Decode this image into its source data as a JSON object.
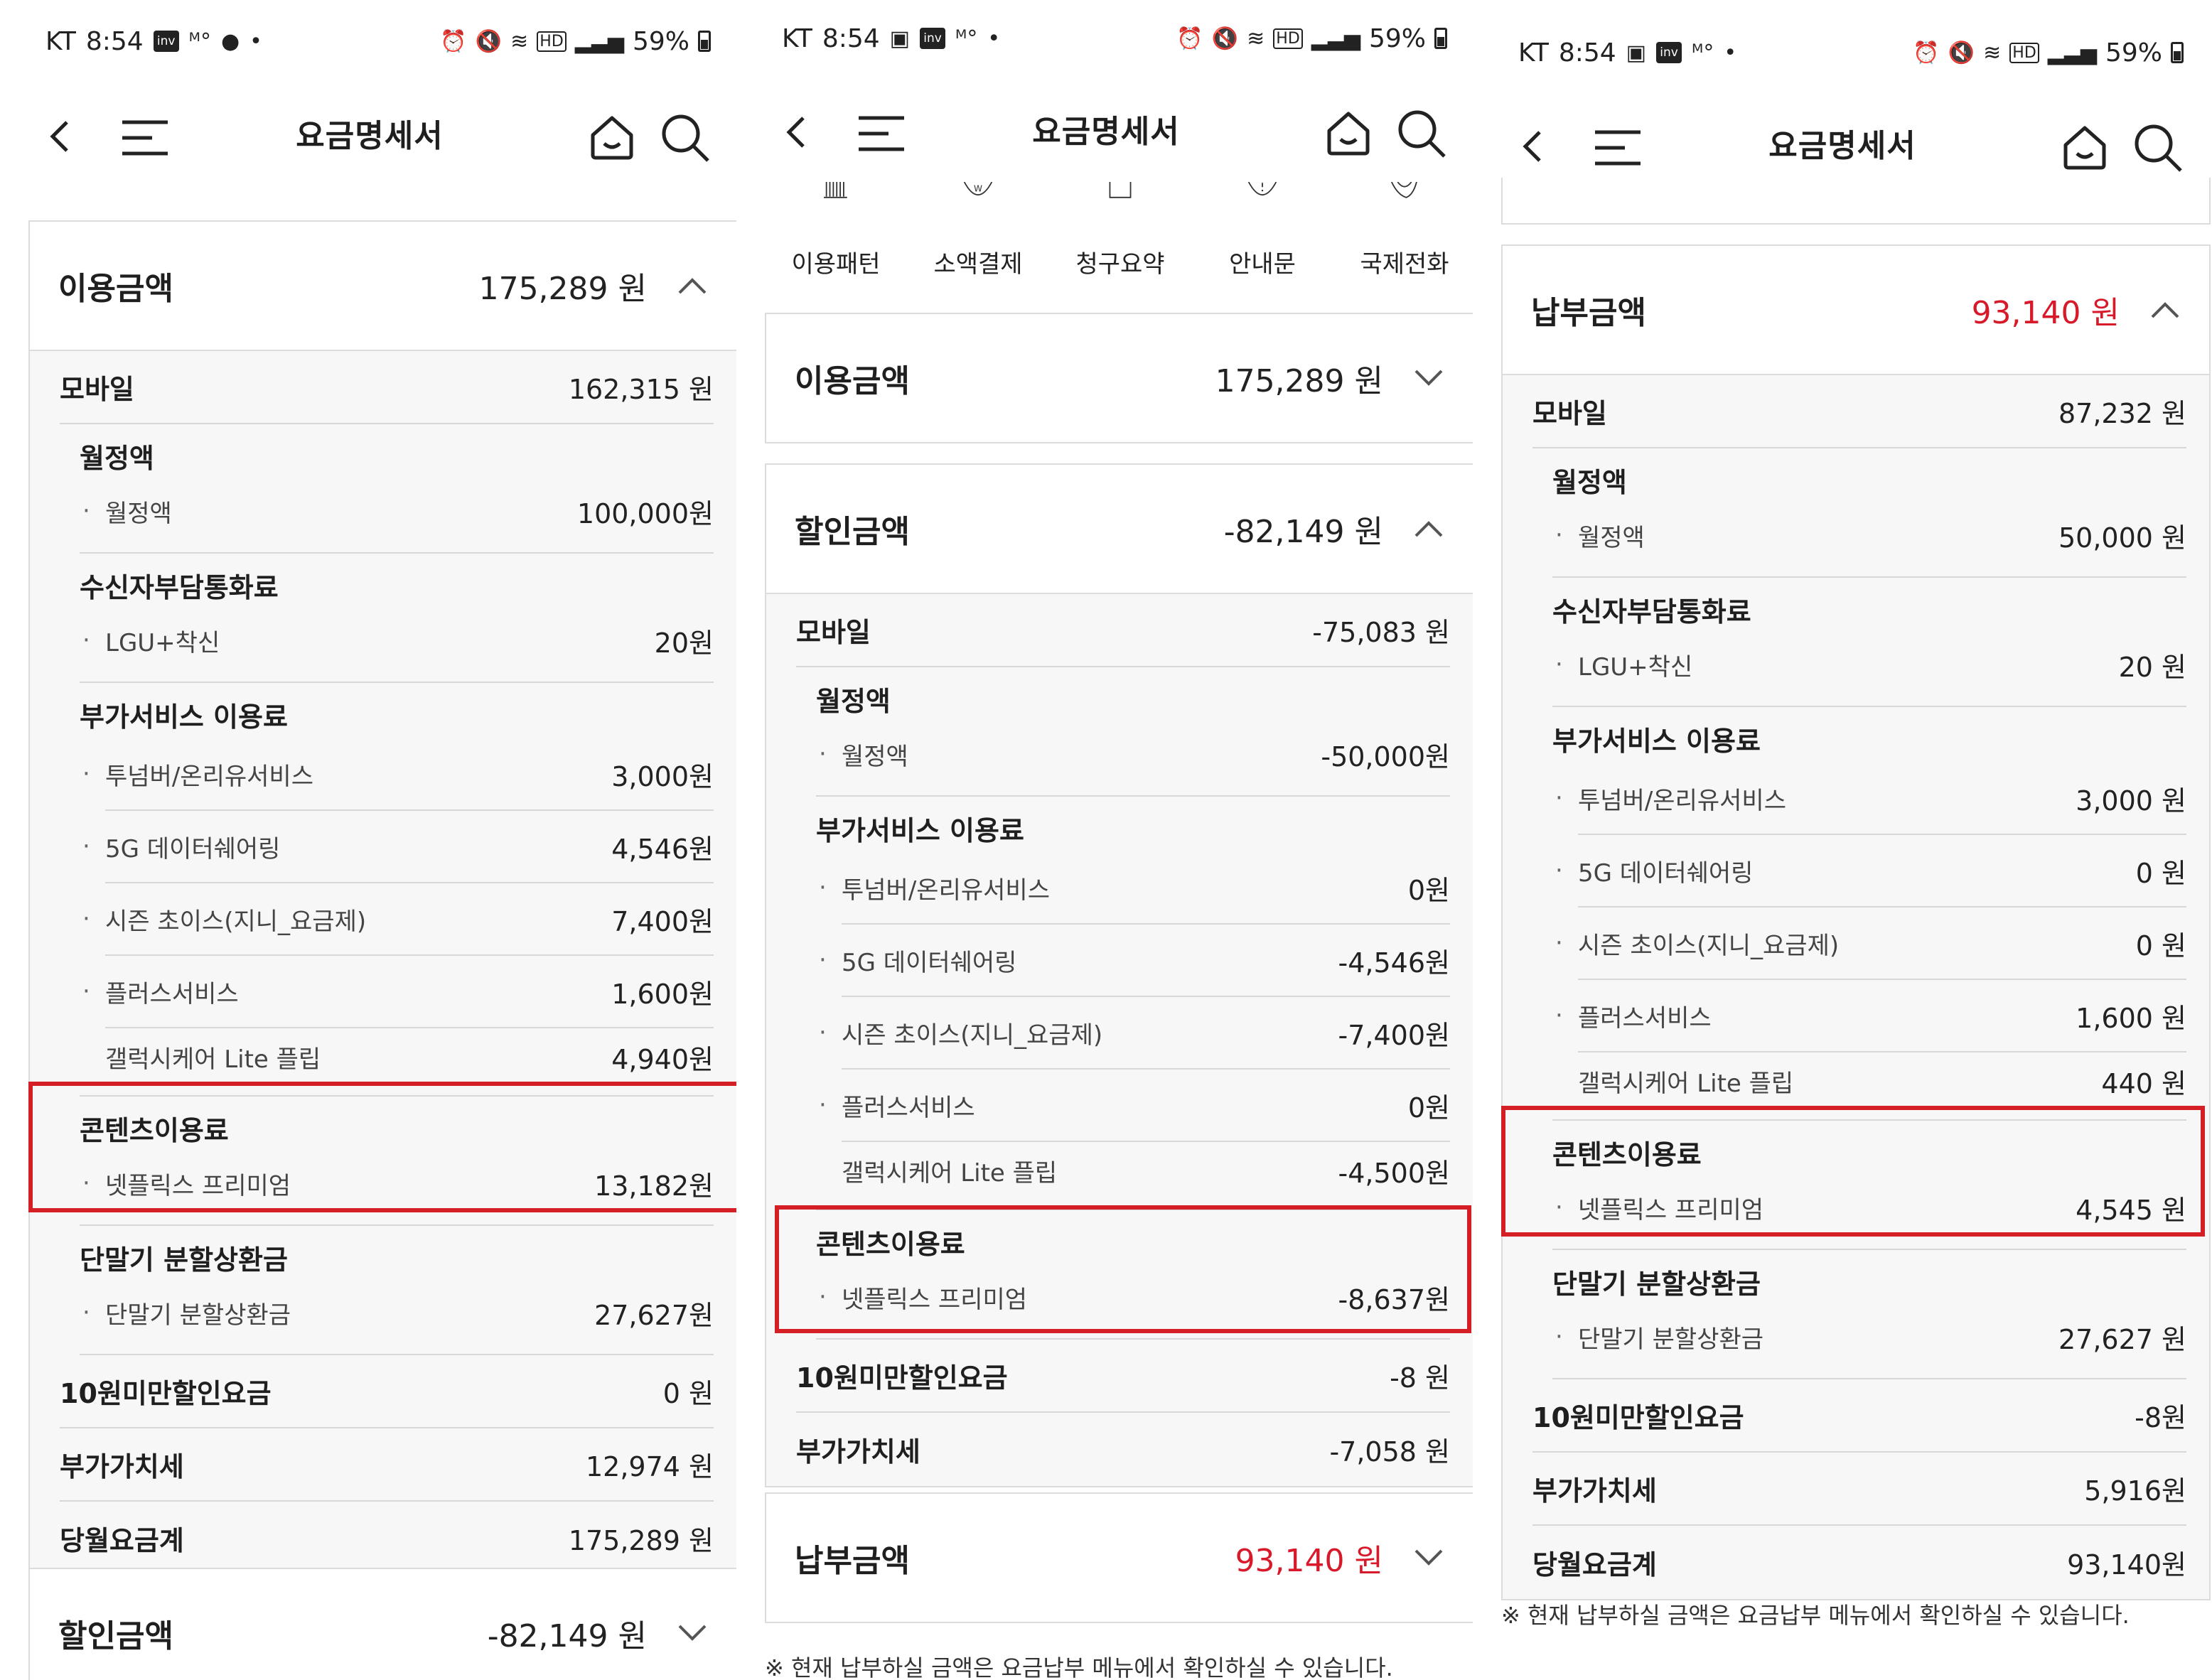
{
  "status_bar": {
    "p1": {
      "carrier": "KT",
      "time": "8:54",
      "battery": "59%"
    },
    "p2": {
      "carrier": "KT",
      "time": "8:54",
      "battery": "59%"
    },
    "p3": {
      "carrier": "KT",
      "time": "8:54",
      "battery": "59%"
    }
  },
  "nav": {
    "title": "요금명세서"
  },
  "tabs": [
    "이용패턴",
    "소액결제",
    "청구요약",
    "안내문",
    "국제전화"
  ],
  "note": "※ 현재 납부하실 금액은 요금납부 메뉴에서 확인하실 수 있습니다.",
  "panel1": {
    "usage": {
      "label": "이용금액",
      "amount": "175,289 원",
      "mobile": {
        "label": "모바일",
        "value": "162,315 원"
      },
      "groups": [
        {
          "title": "월정액",
          "items": [
            {
              "name": "월정액",
              "value": "100,000원"
            }
          ]
        },
        {
          "title": "수신자부담통화료",
          "items": [
            {
              "name": "LGU+착신",
              "value": "20원"
            }
          ]
        },
        {
          "title": "부가서비스 이용료",
          "items": [
            {
              "name": "투넘버/온리유서비스",
              "value": "3,000원"
            },
            {
              "name": "5G 데이터쉐어링",
              "value": "4,546원"
            },
            {
              "name": "시즌 초이스(지니_요금제)",
              "value": "7,400원"
            },
            {
              "name": "플러스서비스",
              "value": "1,600원"
            },
            {
              "name": "갤럭시케어 Lite 플립",
              "value": "4,940원"
            }
          ]
        },
        {
          "title": "콘텐츠이용료",
          "items": [
            {
              "name": "넷플릭스 프리미엄",
              "value": "13,182원"
            }
          ]
        },
        {
          "title": "단말기 분할상환금",
          "items": [
            {
              "name": "단말기 분할상환금",
              "value": "27,627원"
            }
          ]
        }
      ],
      "rows": [
        {
          "label": "10원미만할인요금",
          "value": "0 원"
        },
        {
          "label": "부가가치세",
          "value": "12,974 원"
        },
        {
          "label": "당월요금계",
          "value": "175,289 원"
        }
      ]
    },
    "discount": {
      "label": "할인금액",
      "amount": "-82,149 원"
    }
  },
  "panel2": {
    "usage": {
      "label": "이용금액",
      "amount": "175,289 원"
    },
    "discount": {
      "label": "할인금액",
      "amount": "-82,149 원",
      "mobile": {
        "label": "모바일",
        "value": "-75,083 원"
      },
      "groups": [
        {
          "title": "월정액",
          "items": [
            {
              "name": "월정액",
              "value": "-50,000원"
            }
          ]
        },
        {
          "title": "부가서비스 이용료",
          "items": [
            {
              "name": "투넘버/온리유서비스",
              "value": "0원"
            },
            {
              "name": "5G 데이터쉐어링",
              "value": "-4,546원"
            },
            {
              "name": "시즌 초이스(지니_요금제)",
              "value": "-7,400원"
            },
            {
              "name": "플러스서비스",
              "value": "0원"
            },
            {
              "name": "갤럭시케어 Lite 플립",
              "value": "-4,500원"
            }
          ]
        },
        {
          "title": "콘텐츠이용료",
          "items": [
            {
              "name": "넷플릭스 프리미엄",
              "value": "-8,637원"
            }
          ]
        }
      ],
      "rows": [
        {
          "label": "10원미만할인요금",
          "value": "-8 원"
        },
        {
          "label": "부가가치세",
          "value": "-7,058 원"
        }
      ]
    },
    "payment": {
      "label": "납부금액",
      "amount": "93,140 원"
    }
  },
  "panel3": {
    "payment": {
      "label": "납부금액",
      "amount": "93,140 원",
      "mobile": {
        "label": "모바일",
        "value": "87,232 원"
      },
      "groups": [
        {
          "title": "월정액",
          "items": [
            {
              "name": "월정액",
              "value": "50,000 원"
            }
          ]
        },
        {
          "title": "수신자부담통화료",
          "items": [
            {
              "name": "LGU+착신",
              "value": "20 원"
            }
          ]
        },
        {
          "title": "부가서비스 이용료",
          "items": [
            {
              "name": "투넘버/온리유서비스",
              "value": "3,000 원"
            },
            {
              "name": "5G 데이터쉐어링",
              "value": "0 원"
            },
            {
              "name": "시즌 초이스(지니_요금제)",
              "value": "0 원"
            },
            {
              "name": "플러스서비스",
              "value": "1,600 원"
            },
            {
              "name": "갤럭시케어 Lite 플립",
              "value": "440 원"
            }
          ]
        },
        {
          "title": "콘텐츠이용료",
          "items": [
            {
              "name": "넷플릭스 프리미엄",
              "value": "4,545 원"
            }
          ]
        },
        {
          "title": "단말기 분할상환금",
          "items": [
            {
              "name": "단말기 분할상환금",
              "value": "27,627 원"
            }
          ]
        }
      ],
      "rows": [
        {
          "label": "10원미만할인요금",
          "value": "-8원"
        },
        {
          "label": "부가가치세",
          "value": "5,916원"
        },
        {
          "label": "당월요금계",
          "value": "93,140원"
        }
      ]
    }
  },
  "colors": {
    "highlight": "#d41f27",
    "payment_amount": "#d7192a"
  }
}
